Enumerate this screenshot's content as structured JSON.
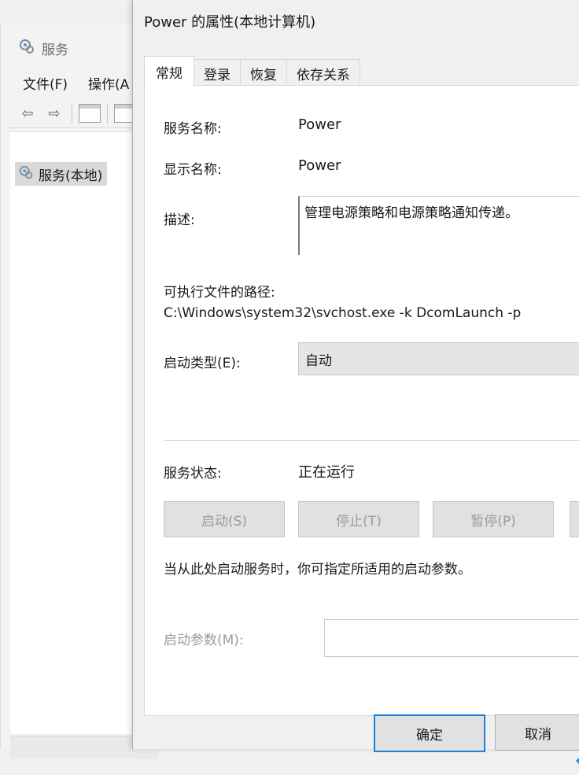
{
  "services_window": {
    "title": "服务",
    "menu": [
      "文件(F)",
      "操作(A"
    ],
    "tree_item": "服务(本地)"
  },
  "dialog": {
    "title": "Power 的属性(本地计算机)",
    "tabs": [
      "常规",
      "登录",
      "恢复",
      "依存关系"
    ],
    "service_name_label": "服务名称:",
    "service_name": "Power",
    "display_name_label": "显示名称:",
    "display_name": "Power",
    "description_label": "描述:",
    "description": "管理电源策略和电源策略通知传递。",
    "path_label": "可执行文件的路径:",
    "path": "C:\\Windows\\system32\\svchost.exe -k DcomLaunch -p",
    "startup_type_label": "启动类型(E):",
    "startup_type": "自动",
    "status_label": "服务状态:",
    "status": "正在运行",
    "start_button": "启动(S)",
    "stop_button": "停止(T)",
    "pause_button": "暂停(P)",
    "hint": "当从此处启动服务时，你可指定所适用的启动参数。",
    "param_label": "启动参数(M):",
    "param_value": "",
    "ok_button": "确定",
    "cancel_button": "取消"
  }
}
